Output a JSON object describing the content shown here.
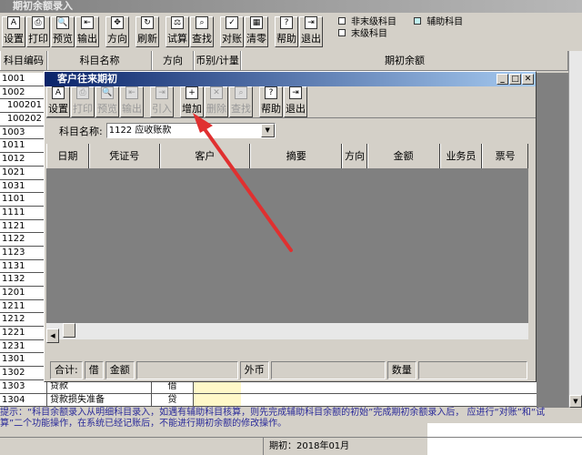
{
  "window": {
    "title": "期初余额录入"
  },
  "toolbar": [
    {
      "label": "设置",
      "icon": "setup-icon",
      "g": "A"
    },
    {
      "label": "打印",
      "icon": "print-icon",
      "g": "⎙"
    },
    {
      "label": "预览",
      "icon": "preview-icon",
      "g": "🔍"
    },
    {
      "label": "输出",
      "icon": "export-icon",
      "g": "⇤"
    },
    {
      "label": "方向",
      "icon": "direction-icon",
      "g": "✥"
    },
    {
      "label": "刷新",
      "icon": "refresh-icon",
      "g": "↻"
    },
    {
      "label": "试算",
      "icon": "balance-icon",
      "g": "⚖"
    },
    {
      "label": "查找",
      "icon": "find-icon",
      "g": "⌕"
    },
    {
      "label": "对账",
      "icon": "reconcile-icon",
      "g": "✓"
    },
    {
      "label": "清零",
      "icon": "clear-icon",
      "g": "▦"
    },
    {
      "label": "帮助",
      "icon": "help-icon",
      "g": "?"
    },
    {
      "label": "退出",
      "icon": "exit-icon",
      "g": "⇥"
    }
  ],
  "legend": {
    "non_leaf": "非末级科目",
    "aux": "辅助科目",
    "leaf": "末级科目",
    "aux_color": "#c0f0f0"
  },
  "columns": [
    "科目编码",
    "科目名称",
    "方向",
    "币别/计量",
    "期初余额"
  ],
  "codes": [
    "1001",
    "1002",
    "100201",
    "100202",
    "1003",
    "1011",
    "1012",
    "1021",
    "1031",
    "1101",
    "1111",
    "1121",
    "1122",
    "1123",
    "1131",
    "1132",
    "1201",
    "1211",
    "1212",
    "1221",
    "1231",
    "1301",
    "1302"
  ],
  "rows": [
    {
      "code": "1303",
      "name": "贷款",
      "dir": "借"
    },
    {
      "code": "1304",
      "name": "贷款损失准备",
      "dir": "贷"
    }
  ],
  "dialog": {
    "title": "客户往来期初",
    "toolbar": [
      {
        "label": "设置",
        "icon": "setup-icon",
        "g": "A",
        "dis": false
      },
      {
        "label": "打印",
        "icon": "print-icon",
        "g": "⎙",
        "dis": true
      },
      {
        "label": "预览",
        "icon": "preview-icon",
        "g": "🔍",
        "dis": true
      },
      {
        "label": "输出",
        "icon": "export-icon",
        "g": "⇤",
        "dis": true
      },
      {
        "label": "引入",
        "icon": "import-icon",
        "g": "⇥",
        "dis": true
      },
      {
        "label": "增加",
        "icon": "add-icon",
        "g": "+",
        "dis": false
      },
      {
        "label": "删除",
        "icon": "delete-icon",
        "g": "✕",
        "dis": true
      },
      {
        "label": "查找",
        "icon": "find-icon",
        "g": "⌕",
        "dis": true
      },
      {
        "label": "帮助",
        "icon": "help-icon",
        "g": "?",
        "dis": false
      },
      {
        "label": "退出",
        "icon": "exit-icon",
        "g": "⇥",
        "dis": false
      }
    ],
    "subject_label": "科目名称:",
    "subject_value": "1122 应收账款",
    "columns": [
      "日期",
      "凭证号",
      "客户",
      "摘要",
      "方向",
      "金额",
      "业务员",
      "票号"
    ],
    "totals": {
      "total": "合计:",
      "debit": "借",
      "amount": "金额",
      "foreign": "外币",
      "qty": "数量"
    }
  },
  "hint": "提示：“科目余额录入从明细科目录入，如遇有辅助科目核算，则先完成辅助科目余额的初始”完成期初余额录入后，                应进行“对账”和“试算”二个功能操作，在系统已经记账后，不能进行期初余额的修改操作。",
  "status": {
    "period": "期初：2018年01月"
  },
  "annotation_color": "#e03030"
}
